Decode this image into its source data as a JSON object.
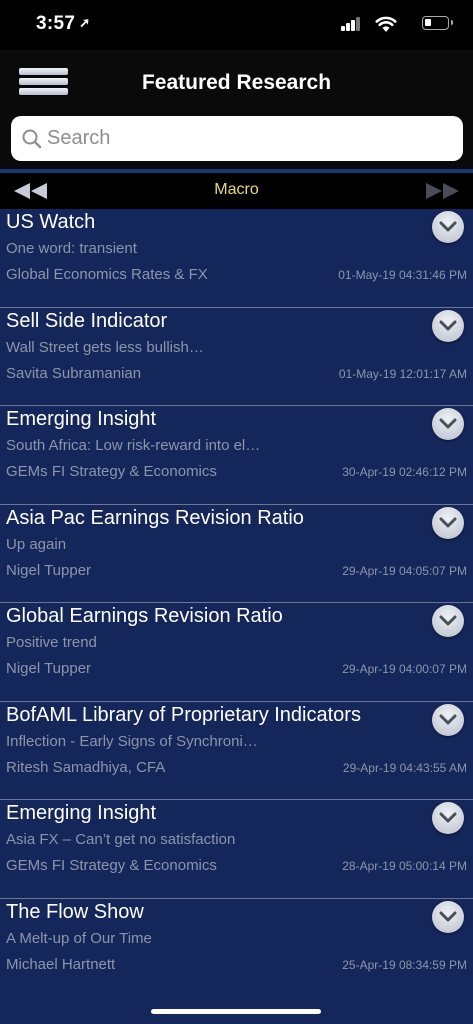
{
  "status_bar": {
    "time": "3:57"
  },
  "header": {
    "title": "Featured Research"
  },
  "search": {
    "placeholder": "Search"
  },
  "category": {
    "label": "Macro"
  },
  "items": [
    {
      "title": "US Watch",
      "subtitle": "One word: transient",
      "author": "Global Economics Rates & FX",
      "date": "01-May-19 04:31:46 PM"
    },
    {
      "title": "Sell Side Indicator",
      "subtitle": "Wall Street gets less bullish…",
      "author": "Savita Subramanian",
      "date": "01-May-19 12:01:17 AM"
    },
    {
      "title": "Emerging Insight",
      "subtitle": "South Africa: Low risk-reward into el…",
      "author": "GEMs FI Strategy & Economics",
      "date": "30-Apr-19 02:46:12 PM"
    },
    {
      "title": "Asia Pac Earnings Revision Ratio",
      "subtitle": "Up again",
      "author": "Nigel Tupper",
      "date": "29-Apr-19 04:05:07 PM"
    },
    {
      "title": "Global Earnings Revision Ratio",
      "subtitle": "Positive trend",
      "author": "Nigel Tupper",
      "date": "29-Apr-19 04:00:07 PM"
    },
    {
      "title": "BofAML Library of Proprietary Indicators",
      "subtitle": "Inflection - Early Signs of Synchroni…",
      "author": "Ritesh Samadhiya, CFA",
      "date": "29-Apr-19 04:43:55 AM"
    },
    {
      "title": "Emerging Insight",
      "subtitle": "Asia FX – Can’t get no satisfaction",
      "author": "GEMs FI Strategy & Economics",
      "date": "28-Apr-19 05:00:14 PM"
    },
    {
      "title": "The Flow Show",
      "subtitle": "A Melt-up of Our Time",
      "author": "Michael Hartnett",
      "date": "25-Apr-19 08:34:59 PM"
    }
  ],
  "colors": {
    "list_background": "#14265a",
    "category_text": "#e8d985",
    "secondary_text": "#8e95ab"
  }
}
